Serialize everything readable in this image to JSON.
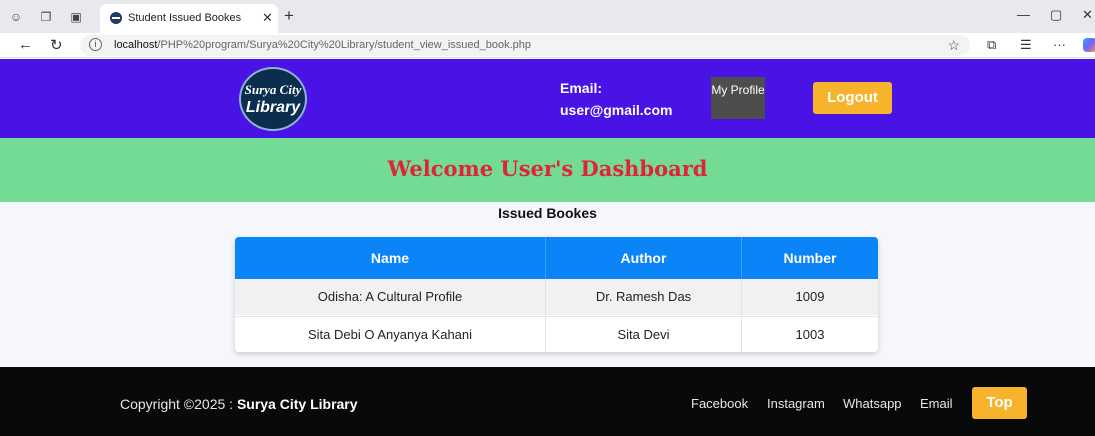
{
  "browser": {
    "tab_title": "Student Issued Bookes",
    "url_host": "localhost",
    "url_path": "/PHP%20program/Surya%20City%20Library/student_view_issued_book.php"
  },
  "header": {
    "logo_line1": "Surya City",
    "logo_line2": "Library",
    "email_label": "Email:",
    "email_value": "user@gmail.com",
    "profile_button": "My Profile",
    "logout_button": "Logout"
  },
  "banner": {
    "welcome": "Welcome User's Dashboard"
  },
  "section_title": "Issued Bookes",
  "table": {
    "headers": [
      "Name",
      "Author",
      "Number"
    ],
    "rows": [
      [
        "Odisha: A Cultural Profile",
        "Dr. Ramesh Das",
        "1009"
      ],
      [
        "Sita Debi O Anyanya Kahani",
        "Sita Devi",
        "1003"
      ]
    ]
  },
  "footer": {
    "copyright_prefix": "Copyright ©2025 : ",
    "copyright_brand": "Surya City Library",
    "links": [
      "Facebook",
      "Instagram",
      "Whatsapp",
      "Email"
    ],
    "top_button": "Top"
  },
  "colors": {
    "header_bg": "#4a13e6",
    "banner_bg": "#73db94",
    "welcome_text": "#e0233d",
    "table_header_bg": "#0b84f7",
    "accent_button": "#f7b32b",
    "footer_bg": "#08090b"
  }
}
